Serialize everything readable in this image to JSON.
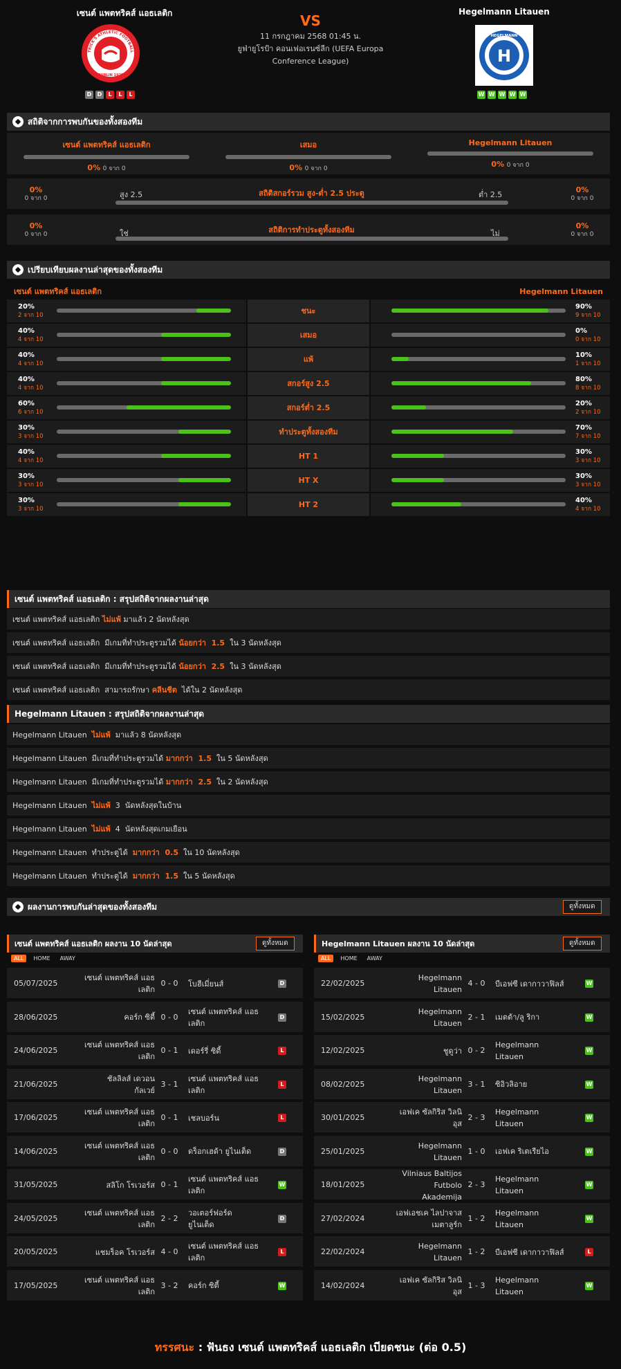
{
  "header": {
    "home_name": "เซนต์ แพตทริคส์ แอธเลติก",
    "away_name": "Hegelmann Litauen",
    "vs": "VS",
    "datetime": "11 กรกฎาคม 2568 01:45 น.",
    "competition": "ยูฟ่ายูโรป้า คอนเฟอเรนซ์ลีก (UEFA Europa Conference League)",
    "home_form": [
      "D",
      "D",
      "L",
      "L",
      "L"
    ],
    "away_form": [
      "W",
      "W",
      "W",
      "W",
      "W"
    ],
    "home_logo_text": "ST. PATRICK'S ATHLETIC FOOTBALL CLUB",
    "home_logo_sub": "DUBLIN 1929",
    "away_logo_text": "HEGELMANN",
    "away_logo_letter": "H"
  },
  "h2h": {
    "title": "สถิติจากการพบกันของทั้งสองทีม",
    "cols": [
      {
        "name": "เซนต์ แพตทริคส์ แอธเลติก",
        "pct": "0%",
        "count": "0 จาก 0",
        "fill": 0
      },
      {
        "name": "เสมอ",
        "pct": "0%",
        "count": "0 จาก 0",
        "fill": 0
      },
      {
        "name": "Hegelmann Litauen",
        "pct": "0%",
        "count": "0 จาก 0",
        "fill": 0
      }
    ],
    "ou": {
      "title": "สถิติสกอร์รวม สูง-ต่ำ 2.5 ประตู",
      "left_label": "สูง 2.5",
      "right_label": "ต่ำ 2.5",
      "left_pct": "0%",
      "left_count": "0 จาก 0",
      "right_pct": "0%",
      "right_count": "0 จาก 0",
      "fill": 0
    },
    "btts": {
      "title": "สถิติการทำประตูทั้งสองทีม",
      "left_label": "ใช่",
      "right_label": "ไม่",
      "left_pct": "0%",
      "left_count": "0 จาก 0",
      "right_pct": "0%",
      "right_count": "0 จาก 0",
      "fill": 0
    }
  },
  "compare": {
    "title": "เปรียบเทียบผลงานล่าสุดของทั้งสองทีม",
    "home_name": "เซนต์ แพตทริคส์ แอธเลติก",
    "away_name": "Hegelmann Litauen",
    "rows": [
      {
        "label": "ชนะ",
        "home_pct": "20%",
        "home_count": "2 จาก 10",
        "home_fill": 0.2,
        "away_pct": "90%",
        "away_count": "9 จาก 10",
        "away_fill": 0.9
      },
      {
        "label": "เสมอ",
        "home_pct": "40%",
        "home_count": "4 จาก 10",
        "home_fill": 0.4,
        "away_pct": "0%",
        "away_count": "0 จาก 10",
        "away_fill": 0
      },
      {
        "label": "แพ้",
        "home_pct": "40%",
        "home_count": "4 จาก 10",
        "home_fill": 0.4,
        "away_pct": "10%",
        "away_count": "1 จาก 10",
        "away_fill": 0.1
      },
      {
        "label": "สกอร์สูง 2.5",
        "home_pct": "40%",
        "home_count": "4 จาก 10",
        "home_fill": 0.4,
        "away_pct": "80%",
        "away_count": "8 จาก 10",
        "away_fill": 0.8
      },
      {
        "label": "สกอร์ต่ำ 2.5",
        "home_pct": "60%",
        "home_count": "6 จาก 10",
        "home_fill": 0.6,
        "away_pct": "20%",
        "away_count": "2 จาก 10",
        "away_fill": 0.2
      },
      {
        "label": "ทำประตูทั้งสองทีม",
        "home_pct": "30%",
        "home_count": "3 จาก 10",
        "home_fill": 0.3,
        "away_pct": "70%",
        "away_count": "7 จาก 10",
        "away_fill": 0.7
      },
      {
        "label": "HT 1",
        "home_pct": "40%",
        "home_count": "4 จาก 10",
        "home_fill": 0.4,
        "away_pct": "30%",
        "away_count": "3 จาก 10",
        "away_fill": 0.3
      },
      {
        "label": "HT X",
        "home_pct": "30%",
        "home_count": "3 จาก 10",
        "home_fill": 0.3,
        "away_pct": "30%",
        "away_count": "3 จาก 10",
        "away_fill": 0.3
      },
      {
        "label": "HT 2",
        "home_pct": "30%",
        "home_count": "3 จาก 10",
        "home_fill": 0.3,
        "away_pct": "40%",
        "away_count": "4 จาก 10",
        "away_fill": 0.4
      }
    ]
  },
  "home_summary": {
    "title": "เซนต์ แพตทริคส์ แอธเลติก : สรุปสถิติจากผลงานล่าสุด",
    "rows": [
      {
        "pre": "เซนต์ แพตทริคส์ แอธเลติก ",
        "hl": "ไม่แพ้",
        "post": " มาแล้ว 2 นัดหลังสุด"
      },
      {
        "pre": "เซนต์ แพตทริคส์ แอธเลติก  มีเกมที่ทำประตูรวมได้ ",
        "hl": "น้อยกว่า  1.5",
        "post": "  ใน 3 นัดหลังสุด"
      },
      {
        "pre": "เซนต์ แพตทริคส์ แอธเลติก  มีเกมที่ทำประตูรวมได้ ",
        "hl": "น้อยกว่า  2.5",
        "post": "  ใน 3 นัดหลังสุด"
      },
      {
        "pre": "เซนต์ แพตทริคส์ แอธเลติก  สามารถรักษา ",
        "hl": "คลีนชีต",
        "post": "  ได้ใน 2 นัดหลังสุด"
      }
    ]
  },
  "away_summary": {
    "title": "Hegelmann Litauen : สรุปสถิติจากผลงานล่าสุด",
    "rows": [
      {
        "pre": "Hegelmann Litauen  ",
        "hl": "ไม่แพ้",
        "post": "  มาแล้ว 8 นัดหลังสุด"
      },
      {
        "pre": "Hegelmann Litauen  มีเกมที่ทำประตูรวมได้ ",
        "hl": "มากกว่า  1.5",
        "post": "  ใน 5 นัดหลังสุด"
      },
      {
        "pre": "Hegelmann Litauen  มีเกมที่ทำประตูรวมได้ ",
        "hl": "มากกว่า  2.5",
        "post": "  ใน 2 นัดหลังสุด"
      },
      {
        "pre": "Hegelmann Litauen  ",
        "hl": "ไม่แพ้",
        "post": "  3  นัดหลังสุดในบ้าน"
      },
      {
        "pre": "Hegelmann Litauen  ",
        "hl": "ไม่แพ้",
        "post": "  4  นัดหลังสุดเกมเยือน"
      },
      {
        "pre": "Hegelmann Litauen  ทำประตูได้  ",
        "hl": "มากกว่า  0.5",
        "post": "  ใน 10 นัดหลังสุด"
      },
      {
        "pre": "Hegelmann Litauen  ทำประตูได้  ",
        "hl": "มากกว่า  1.5",
        "post": "  ใน 5 นัดหลังสุด"
      }
    ]
  },
  "recent": {
    "title": "ผลงานการพบกันล่าสุดของทั้งสองทีม",
    "view_all": "ดูทั้งหมด",
    "tabs": [
      "ALL",
      "HOME",
      "AWAY"
    ],
    "home_title": "เซนต์ แพตทริคส์ แอธเลติก ผลงาน 10 นัดล่าสุด",
    "away_title": "Hegelmann Litauen ผลงาน 10 นัดล่าสุด",
    "home_matches": [
      {
        "date": "05/07/2025",
        "home": "เซนต์ แพตทริคส์ แอธ\nเลติก",
        "score": "0 - 0",
        "away": "โบฮีเมี่ยนส์",
        "res": "D"
      },
      {
        "date": "28/06/2025",
        "home": "คอร์ก ซิตี้",
        "score": "0 - 0",
        "away": "เซนต์ แพตทริคส์ แอธ\nเลติก",
        "res": "D"
      },
      {
        "date": "24/06/2025",
        "home": "เซนต์ แพตทริคส์ แอธ\nเลติก",
        "score": "0 - 1",
        "away": "เดอร์รี่ ซิตี้",
        "res": "L"
      },
      {
        "date": "21/06/2025",
        "home": "ชัลลิลส์ เดวอน\nกัลเวย์",
        "score": "3 - 1",
        "away": "เซนต์ แพตทริคส์ แอธ\nเลติก",
        "res": "L"
      },
      {
        "date": "17/06/2025",
        "home": "เซนต์ แพตทริคส์ แอธ\nเลติก",
        "score": "0 - 1",
        "away": "เชลบอร์น",
        "res": "L"
      },
      {
        "date": "14/06/2025",
        "home": "เซนต์ แพตทริคส์ แอธ\nเลติก",
        "score": "0 - 0",
        "away": "ดร็อกเฮด้า ยูไนเต็ด",
        "res": "D"
      },
      {
        "date": "31/05/2025",
        "home": "สลิโก โรเวอร์ส",
        "score": "0 - 1",
        "away": "เซนต์ แพตทริคส์ แอธ\nเลติก",
        "res": "W"
      },
      {
        "date": "24/05/2025",
        "home": "เซนต์ แพตทริคส์ แอธ\nเลติก",
        "score": "2 - 2",
        "away": "วอเตอร์ฟอร์ด\nยูไนเต็ด",
        "res": "D"
      },
      {
        "date": "20/05/2025",
        "home": "แชมร็อค โรเวอร์ส",
        "score": "4 - 0",
        "away": "เซนต์ แพตทริคส์ แอธ\nเลติก",
        "res": "L"
      },
      {
        "date": "17/05/2025",
        "home": "เซนต์ แพตทริคส์ แอธ\nเลติก",
        "score": "3 - 2",
        "away": "คอร์ก ซิตี้",
        "res": "W"
      }
    ],
    "away_matches": [
      {
        "date": "22/02/2025",
        "home": "Hegelmann\nLitauen",
        "score": "4 - 0",
        "away": "บีเอฟซี เดากาวาฟิลส์",
        "res": "W"
      },
      {
        "date": "15/02/2025",
        "home": "Hegelmann\nLitauen",
        "score": "2 - 1",
        "away": "เมตต้า/ลู ริกา",
        "res": "W"
      },
      {
        "date": "12/02/2025",
        "home": "ชูดูว่า",
        "score": "0 - 2",
        "away": "Hegelmann\nLitauen",
        "res": "W"
      },
      {
        "date": "08/02/2025",
        "home": "Hegelmann\nLitauen",
        "score": "3 - 1",
        "away": "ซิอิวลิอาย",
        "res": "W"
      },
      {
        "date": "30/01/2025",
        "home": "เอฟเค ซัลกิริส วิลนิ\nอุส",
        "score": "2 - 3",
        "away": "Hegelmann\nLitauen",
        "res": "W"
      },
      {
        "date": "25/01/2025",
        "home": "Hegelmann\nLitauen",
        "score": "1 - 0",
        "away": "เอฟเค ริเตเรียไอ",
        "res": "W"
      },
      {
        "date": "18/01/2025",
        "home": "Vilniaus Baltijos\nFutbolo\nAkademija",
        "score": "2 - 3",
        "away": "Hegelmann\nLitauen",
        "res": "W"
      },
      {
        "date": "27/02/2024",
        "home": "เอฟเอชเค ไลปาจาส\nเมตาลูร์ก",
        "score": "1 - 2",
        "away": "Hegelmann\nLitauen",
        "res": "W"
      },
      {
        "date": "22/02/2024",
        "home": "Hegelmann\nLitauen",
        "score": "1 - 2",
        "away": "บีเอฟซี เดากาวาฟิลส์",
        "res": "L"
      },
      {
        "date": "14/02/2024",
        "home": "เอฟเค ซัลกิริส วิลนิ\nอุส",
        "score": "1 - 3",
        "away": "Hegelmann\nLitauen",
        "res": "W"
      }
    ]
  },
  "verdict": {
    "label": "ทรรศนะ",
    "sep": " : ",
    "text": "ฟันธง เซนต์ แพตทริคส์ แอธเลติก เบียดชนะ (ต่อ 0.5)"
  },
  "colors": {
    "accent": "#ff6a1a",
    "win": "#4bc21a",
    "loss": "#d41c1c",
    "draw": "#777777"
  }
}
